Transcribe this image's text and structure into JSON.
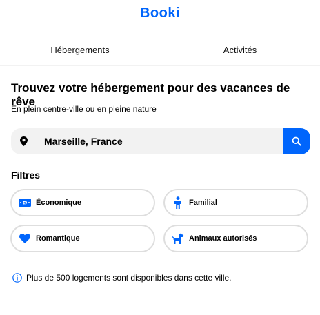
{
  "header": {
    "logo_text": "Booki",
    "brand_color": "#0065FC"
  },
  "tabs": [
    {
      "label": "Hébergements"
    },
    {
      "label": "Activités"
    }
  ],
  "main": {
    "title": "Trouvez votre hébergement pour des vacances de rêve",
    "subtitle": "En plein centre-ville ou en pleine nature"
  },
  "search": {
    "location_icon": "location-pin-icon",
    "value": "Marseille, France",
    "button_icon": "search-icon"
  },
  "filters": {
    "title": "Filtres",
    "items": [
      {
        "label": "Économique",
        "icon": "money-icon"
      },
      {
        "label": "Familial",
        "icon": "person-icon"
      },
      {
        "label": "Romantique",
        "icon": "heart-icon"
      },
      {
        "label": "Animaux autorisés",
        "icon": "dog-icon"
      }
    ]
  },
  "info": {
    "icon": "info-icon",
    "text": "Plus de 500 logements sont disponibles dans cette ville."
  }
}
